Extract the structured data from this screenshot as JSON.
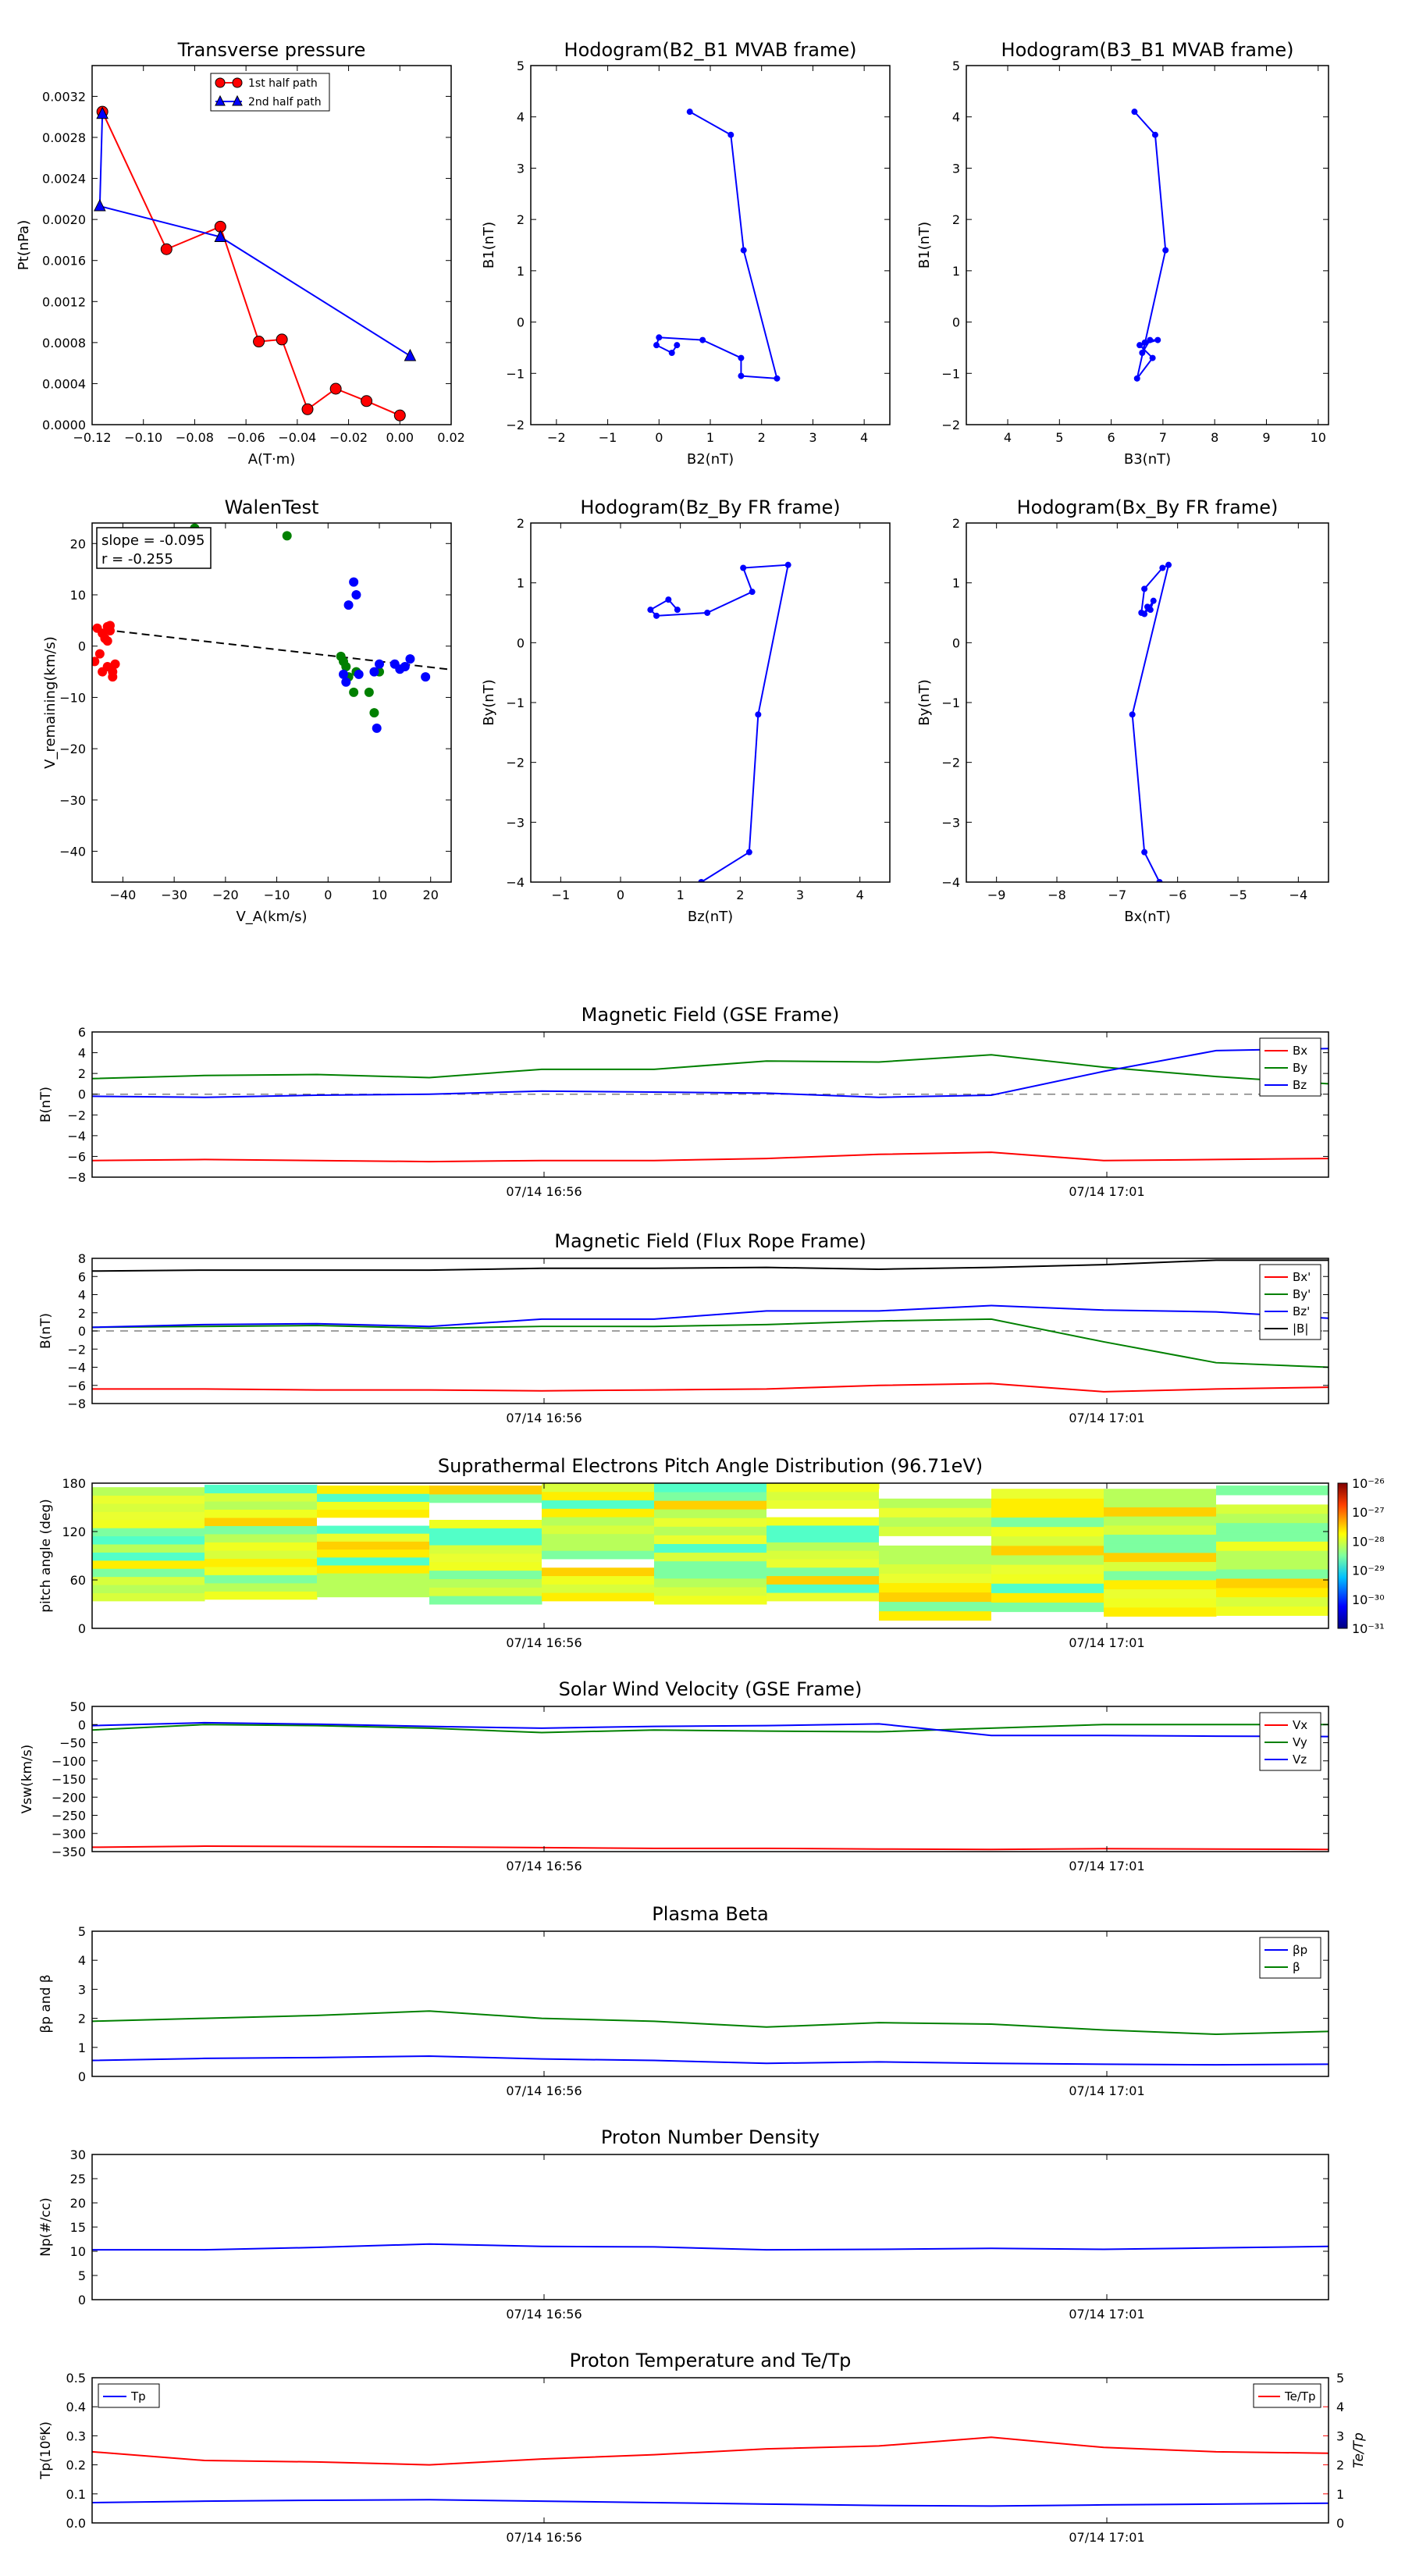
{
  "colors": {
    "red": "#ff0000",
    "green": "#008000",
    "blue": "#0000ff",
    "black": "#000000",
    "gray": "#808080"
  },
  "scatter_panels": [
    {
      "id": "transverse-pressure",
      "title": "Transverse pressure",
      "xlabel": "A(T·m)",
      "ylabel": "Pt(nPa)",
      "xlim": [
        -0.12,
        0.02
      ],
      "ylim": [
        0,
        0.0035
      ],
      "xticks": [
        "−0.12",
        "−0.10",
        "−0.08",
        "−0.06",
        "−0.04",
        "−0.02",
        "0.00",
        "0.02"
      ],
      "yticks": [
        "0.0000",
        "0.0004",
        "0.0008",
        "0.0012",
        "0.0016",
        "0.0020",
        "0.0024",
        "0.0028",
        "0.0032"
      ],
      "legend": [
        "1st half path",
        "2nd half path"
      ]
    },
    {
      "id": "hodogram-b2-b1",
      "title": "Hodogram(B2_B1 MVAB frame)",
      "xlabel": "B2(nT)",
      "ylabel": "B1(nT)",
      "xlim": [
        -2.5,
        4.5
      ],
      "ylim": [
        -2,
        5
      ],
      "xticks": [
        "−2",
        "−1",
        "0",
        "1",
        "2",
        "3",
        "4"
      ],
      "yticks": [
        "−2",
        "−1",
        "0",
        "1",
        "2",
        "3",
        "4",
        "5"
      ]
    },
    {
      "id": "hodogram-b3-b1",
      "title": "Hodogram(B3_B1 MVAB frame)",
      "xlabel": "B3(nT)",
      "ylabel": "B1(nT)",
      "xlim": [
        3.2,
        10.2
      ],
      "ylim": [
        -2,
        5
      ],
      "xticks": [
        "4",
        "5",
        "6",
        "7",
        "8",
        "9",
        "10"
      ],
      "yticks": [
        "−2",
        "−1",
        "0",
        "1",
        "2",
        "3",
        "4",
        "5"
      ]
    },
    {
      "id": "walen-test",
      "title": "WalenTest",
      "xlabel": "V_A(km/s)",
      "ylabel": "V_remaining(km/s)",
      "xlim": [
        -46,
        24
      ],
      "ylim": [
        -46,
        24
      ],
      "xticks": [
        "−40",
        "−30",
        "−20",
        "−10",
        "0",
        "10",
        "20"
      ],
      "yticks": [
        "−40",
        "−30",
        "−20",
        "−10",
        "0",
        "10",
        "20"
      ],
      "annot1": "slope = -0.095",
      "annot2": "r = -0.255"
    },
    {
      "id": "hodogram-bz-by",
      "title": "Hodogram(Bz_By FR frame)",
      "xlabel": "Bz(nT)",
      "ylabel": "By(nT)",
      "xlim": [
        -1.5,
        4.5
      ],
      "ylim": [
        -4,
        2
      ],
      "xticks": [
        "−1",
        "0",
        "1",
        "2",
        "3",
        "4"
      ],
      "yticks": [
        "−4",
        "−3",
        "−2",
        "−1",
        "0",
        "1",
        "2"
      ]
    },
    {
      "id": "hodogram-bx-by",
      "title": "Hodogram(Bx_By FR frame)",
      "xlabel": "Bx(nT)",
      "ylabel": "By(nT)",
      "xlim": [
        -9.5,
        -3.5
      ],
      "ylim": [
        -4,
        2
      ],
      "xticks": [
        "−9",
        "−8",
        "−7",
        "−6",
        "−5",
        "−4"
      ],
      "yticks": [
        "−4",
        "−3",
        "−2",
        "−1",
        "0",
        "1",
        "2"
      ]
    }
  ],
  "ts_panels": [
    {
      "id": "mag-gse",
      "title": "Magnetic Field (GSE Frame)",
      "ylabel": "B(nT)",
      "ylim": [
        -8,
        6
      ],
      "yticks": [
        "−8",
        "−6",
        "−4",
        "−2",
        "0",
        "2",
        "4",
        "6"
      ],
      "legend": [
        "Bx",
        "By",
        "Bz"
      ]
    },
    {
      "id": "mag-fr",
      "title": "Magnetic Field (Flux Rope Frame)",
      "ylabel": "B(nT)",
      "ylim": [
        -8,
        8
      ],
      "yticks": [
        "−8",
        "−6",
        "−4",
        "−2",
        "0",
        "2",
        "4",
        "6",
        "8"
      ],
      "legend": [
        "Bx'",
        "By'",
        "Bz'",
        "|B|"
      ]
    },
    {
      "id": "pad",
      "title": "Suprathermal Electrons Pitch Angle Distribution (96.71eV)",
      "ylabel": "pitch angle (deg)",
      "ylim": [
        0,
        180
      ],
      "yticks": [
        "0",
        "60",
        "120",
        "180"
      ]
    },
    {
      "id": "vsw",
      "title": "Solar Wind Velocity (GSE Frame)",
      "ylabel": "Vsw(km/s)",
      "ylim": [
        -350,
        50
      ],
      "yticks": [
        "−350",
        "−300",
        "−250",
        "−200",
        "−150",
        "−100",
        "−50",
        "0",
        "50"
      ],
      "legend": [
        "Vx",
        "Vy",
        "Vz"
      ]
    },
    {
      "id": "beta",
      "title": "Plasma Beta",
      "ylabel": "βp and β",
      "ylim": [
        0,
        5
      ],
      "yticks": [
        "0",
        "1",
        "2",
        "3",
        "4",
        "5"
      ],
      "legend": [
        "βp",
        "β"
      ]
    },
    {
      "id": "np",
      "title": "Proton Number Density",
      "ylabel": "Np(#/cc)",
      "ylim": [
        0,
        30
      ],
      "yticks": [
        "0",
        "5",
        "10",
        "15",
        "20",
        "25",
        "30"
      ]
    },
    {
      "id": "tp",
      "title": "Proton Temperature and Te/Tp",
      "ylabel": "Tp(10⁶K)",
      "ylim": [
        0,
        0.5
      ],
      "yticks": [
        "0.0",
        "0.1",
        "0.2",
        "0.3",
        "0.4",
        "0.5"
      ],
      "legend": [
        "Tp"
      ],
      "ylabel2": "Te/Tp",
      "ylim2": [
        0,
        5
      ],
      "yticks2": [
        "0",
        "1",
        "2",
        "3",
        "4",
        "5"
      ],
      "legend2": [
        "Te/Tp"
      ]
    }
  ],
  "time_ticks": [
    "07/14 16:56",
    "07/14 17:01"
  ],
  "colorbar_ticks": [
    "10⁻²⁶",
    "10⁻²⁷",
    "10⁻²⁸",
    "10⁻²⁹",
    "10⁻³⁰",
    "10⁻³¹"
  ],
  "chart_data": [
    {
      "type": "scatter",
      "title": "Transverse pressure",
      "xlabel": "A(T·m)",
      "ylabel": "Pt(nPa)",
      "xlim": [
        -0.12,
        0.02
      ],
      "ylim": [
        0,
        0.0035
      ],
      "series": [
        {
          "name": "1st half path",
          "marker": "circle",
          "x": [
            -0.116,
            -0.091,
            -0.07,
            -0.055,
            -0.046,
            -0.036,
            -0.025,
            -0.013,
            0.0
          ],
          "y": [
            0.00305,
            0.00171,
            0.00193,
            0.00081,
            0.00083,
            0.00015,
            0.00035,
            0.00023,
            9e-05
          ]
        },
        {
          "name": "2nd half path",
          "marker": "triangle",
          "x": [
            -0.116,
            -0.117,
            -0.07,
            0.004
          ],
          "y": [
            0.00303,
            0.00213,
            0.00183,
            0.00067
          ]
        }
      ]
    },
    {
      "type": "line",
      "title": "Hodogram(B2_B1 MVAB frame)",
      "xlabel": "B2(nT)",
      "ylabel": "B1(nT)",
      "x": [
        0.6,
        1.4,
        1.65,
        2.3,
        1.6,
        1.6,
        0.85,
        0.0,
        -0.05,
        0.25,
        0.35
      ],
      "y": [
        4.1,
        3.65,
        1.4,
        -1.1,
        -1.05,
        -0.7,
        -0.35,
        -0.3,
        -0.45,
        -0.6,
        -0.45
      ]
    },
    {
      "type": "line",
      "title": "Hodogram(B3_B1 MVAB frame)",
      "xlabel": "B3(nT)",
      "ylabel": "B1(nT)",
      "x": [
        6.45,
        6.85,
        7.05,
        6.5,
        6.8,
        6.55,
        6.9,
        6.75,
        6.6,
        6.65
      ],
      "y": [
        4.1,
        3.65,
        1.4,
        -1.1,
        -0.7,
        -0.45,
        -0.35,
        -0.35,
        -0.6,
        -0.4
      ]
    },
    {
      "type": "scatter",
      "title": "WalenTest",
      "xlabel": "V_A(km/s)",
      "ylabel": "V_remaining(km/s)",
      "xlim": [
        -46,
        24
      ],
      "ylim": [
        -46,
        24
      ],
      "fit_line": {
        "slope": -0.095,
        "intercept": -1.5
      },
      "series": [
        {
          "color": "red",
          "x": [
            -45,
            -43,
            -44,
            -43.5,
            -42.5,
            -43,
            -42.5,
            -44.5,
            -44,
            -42,
            -41.5,
            -43,
            -45.5,
            -42
          ],
          "y": [
            3.5,
            3.8,
            2.5,
            1.5,
            4,
            1,
            3,
            -1.5,
            -5,
            -6,
            -3.5,
            -4,
            -3,
            -5
          ]
        },
        {
          "color": "green",
          "x": [
            -26,
            -8,
            2.5,
            3,
            3.5,
            4,
            5,
            5.5,
            8,
            9,
            10
          ],
          "y": [
            23,
            21.5,
            -2,
            -3,
            -4,
            -6,
            -9,
            -5,
            -9,
            -13,
            -5
          ]
        },
        {
          "color": "blue",
          "x": [
            3,
            4,
            5,
            5.5,
            6,
            9,
            10,
            13,
            14,
            15,
            16,
            19,
            9.5,
            3.5
          ],
          "y": [
            -5.5,
            8,
            12.5,
            10,
            -5.5,
            -5,
            -3.5,
            -3.5,
            -4.5,
            -4,
            -2.5,
            -6,
            -16,
            -7
          ]
        }
      ]
    },
    {
      "type": "line",
      "title": "Hodogram(Bz_By FR frame)",
      "xlabel": "Bz(nT)",
      "ylabel": "By(nT)",
      "x": [
        1.35,
        2.15,
        2.3,
        2.8,
        2.05,
        2.2,
        1.45,
        0.6,
        0.5,
        0.8,
        0.95
      ],
      "y": [
        -4.0,
        -3.5,
        -1.2,
        1.3,
        1.25,
        0.85,
        0.5,
        0.45,
        0.55,
        0.72,
        0.55
      ]
    },
    {
      "type": "line",
      "title": "Hodogram(Bx_By FR frame)",
      "xlabel": "Bx(nT)",
      "ylabel": "By(nT)",
      "x": [
        -6.3,
        -6.55,
        -6.75,
        -6.15,
        -6.25,
        -6.55,
        -6.6,
        -6.45,
        -6.4,
        -6.55,
        -6.5
      ],
      "y": [
        -4.0,
        -3.5,
        -1.2,
        1.3,
        1.25,
        0.9,
        0.5,
        0.55,
        0.7,
        0.48,
        0.6
      ]
    },
    {
      "type": "line",
      "title": "Magnetic Field (GSE Frame)",
      "ylabel": "B(nT)",
      "ylim": [
        -8,
        6
      ],
      "series": [
        {
          "name": "Bx",
          "x": [
            0,
            1,
            2,
            3,
            4,
            5,
            6,
            7,
            8,
            9,
            10,
            11
          ],
          "y": [
            -6.4,
            -6.3,
            -6.4,
            -6.5,
            -6.4,
            -6.4,
            -6.2,
            -5.8,
            -5.6,
            -6.4,
            -6.3,
            -6.2
          ]
        },
        {
          "name": "By",
          "x": [
            0,
            1,
            2,
            3,
            4,
            5,
            6,
            7,
            8,
            9,
            10,
            11
          ],
          "y": [
            1.5,
            1.8,
            1.9,
            1.6,
            2.4,
            2.4,
            3.2,
            3.1,
            3.8,
            2.6,
            1.7,
            1.0
          ]
        },
        {
          "name": "Bz",
          "x": [
            0,
            1,
            2,
            3,
            4,
            5,
            6,
            7,
            8,
            9,
            10,
            11
          ],
          "y": [
            -0.2,
            -0.3,
            -0.1,
            0.0,
            0.3,
            0.2,
            0.1,
            -0.3,
            -0.1,
            2.2,
            4.2,
            4.4
          ]
        }
      ],
      "zero_line": true
    },
    {
      "type": "line",
      "title": "Magnetic Field (Flux Rope Frame)",
      "ylabel": "B(nT)",
      "ylim": [
        -8,
        8
      ],
      "series": [
        {
          "name": "Bx'",
          "x": [
            0,
            1,
            2,
            3,
            4,
            5,
            6,
            7,
            8,
            9,
            10,
            11
          ],
          "y": [
            -6.4,
            -6.4,
            -6.5,
            -6.5,
            -6.6,
            -6.5,
            -6.4,
            -6.0,
            -5.8,
            -6.7,
            -6.4,
            -6.2
          ]
        },
        {
          "name": "By'",
          "x": [
            0,
            1,
            2,
            3,
            4,
            5,
            6,
            7,
            8,
            9,
            10,
            11
          ],
          "y": [
            0.4,
            0.5,
            0.6,
            0.3,
            0.5,
            0.5,
            0.7,
            1.1,
            1.3,
            -1.2,
            -3.5,
            -4.0
          ]
        },
        {
          "name": "Bz'",
          "x": [
            0,
            1,
            2,
            3,
            4,
            5,
            6,
            7,
            8,
            9,
            10,
            11
          ],
          "y": [
            0.4,
            0.7,
            0.8,
            0.5,
            1.3,
            1.3,
            2.2,
            2.2,
            2.8,
            2.3,
            2.1,
            1.4
          ]
        },
        {
          "name": "|B|",
          "x": [
            0,
            1,
            2,
            3,
            4,
            5,
            6,
            7,
            8,
            9,
            10,
            11
          ],
          "y": [
            6.6,
            6.7,
            6.7,
            6.7,
            6.9,
            6.9,
            7.0,
            6.8,
            7.0,
            7.3,
            7.8,
            7.8
          ]
        }
      ],
      "zero_line": true
    },
    {
      "type": "heatmap",
      "title": "Suprathermal Electrons Pitch Angle Distribution (96.71eV)",
      "ylabel": "pitch angle (deg)",
      "ylim": [
        0,
        180
      ]
    },
    {
      "type": "line",
      "title": "Solar Wind Velocity (GSE Frame)",
      "ylabel": "Vsw(km/s)",
      "ylim": [
        -350,
        50
      ],
      "series": [
        {
          "name": "Vx",
          "x": [
            0,
            1,
            2,
            3,
            4,
            5,
            6,
            7,
            8,
            9,
            10,
            11
          ],
          "y": [
            -338,
            -335,
            -336,
            -337,
            -339,
            -341,
            -341,
            -343,
            -344,
            -342,
            -343,
            -344
          ]
        },
        {
          "name": "Vy",
          "x": [
            0,
            1,
            2,
            3,
            4,
            5,
            6,
            7,
            8,
            9,
            10,
            11
          ],
          "y": [
            -15,
            0,
            -3,
            -10,
            -22,
            -15,
            -18,
            -20,
            -10,
            0,
            0,
            0
          ]
        },
        {
          "name": "Vz",
          "x": [
            0,
            1,
            2,
            3,
            4,
            5,
            6,
            7,
            8,
            9,
            10,
            11
          ],
          "y": [
            -3,
            5,
            1,
            -5,
            -10,
            -5,
            -3,
            2,
            -30,
            -30,
            -32,
            -33
          ]
        }
      ]
    },
    {
      "type": "line",
      "title": "Plasma Beta",
      "ylabel": "βp and β",
      "ylim": [
        0,
        5
      ],
      "series": [
        {
          "name": "βp",
          "x": [
            0,
            1,
            2,
            3,
            4,
            5,
            6,
            7,
            8,
            9,
            10,
            11
          ],
          "y": [
            0.55,
            0.62,
            0.65,
            0.7,
            0.6,
            0.55,
            0.45,
            0.5,
            0.45,
            0.42,
            0.4,
            0.42
          ]
        },
        {
          "name": "β",
          "x": [
            0,
            1,
            2,
            3,
            4,
            5,
            6,
            7,
            8,
            9,
            10,
            11
          ],
          "y": [
            1.9,
            2.0,
            2.1,
            2.25,
            2.0,
            1.9,
            1.7,
            1.85,
            1.8,
            1.6,
            1.45,
            1.55
          ]
        }
      ]
    },
    {
      "type": "line",
      "title": "Proton Number Density",
      "ylabel": "Np(#/cc)",
      "ylim": [
        0,
        30
      ],
      "series": [
        {
          "x": [
            0,
            1,
            2,
            3,
            4,
            5,
            6,
            7,
            8,
            9,
            10,
            11
          ],
          "y": [
            10.3,
            10.3,
            10.8,
            11.5,
            11.0,
            10.9,
            10.3,
            10.4,
            10.6,
            10.4,
            10.7,
            11.0
          ]
        }
      ]
    },
    {
      "type": "line",
      "title": "Proton Temperature and Te/Tp",
      "ylabel": "Tp(10⁶K)",
      "ylim": [
        0,
        0.5
      ],
      "series": [
        {
          "name": "Tp",
          "axis": "left",
          "x": [
            0,
            1,
            2,
            3,
            4,
            5,
            6,
            7,
            8,
            9,
            10,
            11
          ],
          "y": [
            0.07,
            0.075,
            0.078,
            0.08,
            0.075,
            0.07,
            0.065,
            0.06,
            0.058,
            0.062,
            0.065,
            0.068
          ]
        },
        {
          "name": "Te/Tp",
          "axis": "right",
          "x": [
            0,
            1,
            2,
            3,
            4,
            5,
            6,
            7,
            8,
            9,
            10,
            11
          ],
          "y": [
            2.45,
            2.15,
            2.1,
            2.0,
            2.2,
            2.35,
            2.55,
            2.65,
            2.95,
            2.6,
            2.45,
            2.4
          ]
        }
      ]
    }
  ]
}
